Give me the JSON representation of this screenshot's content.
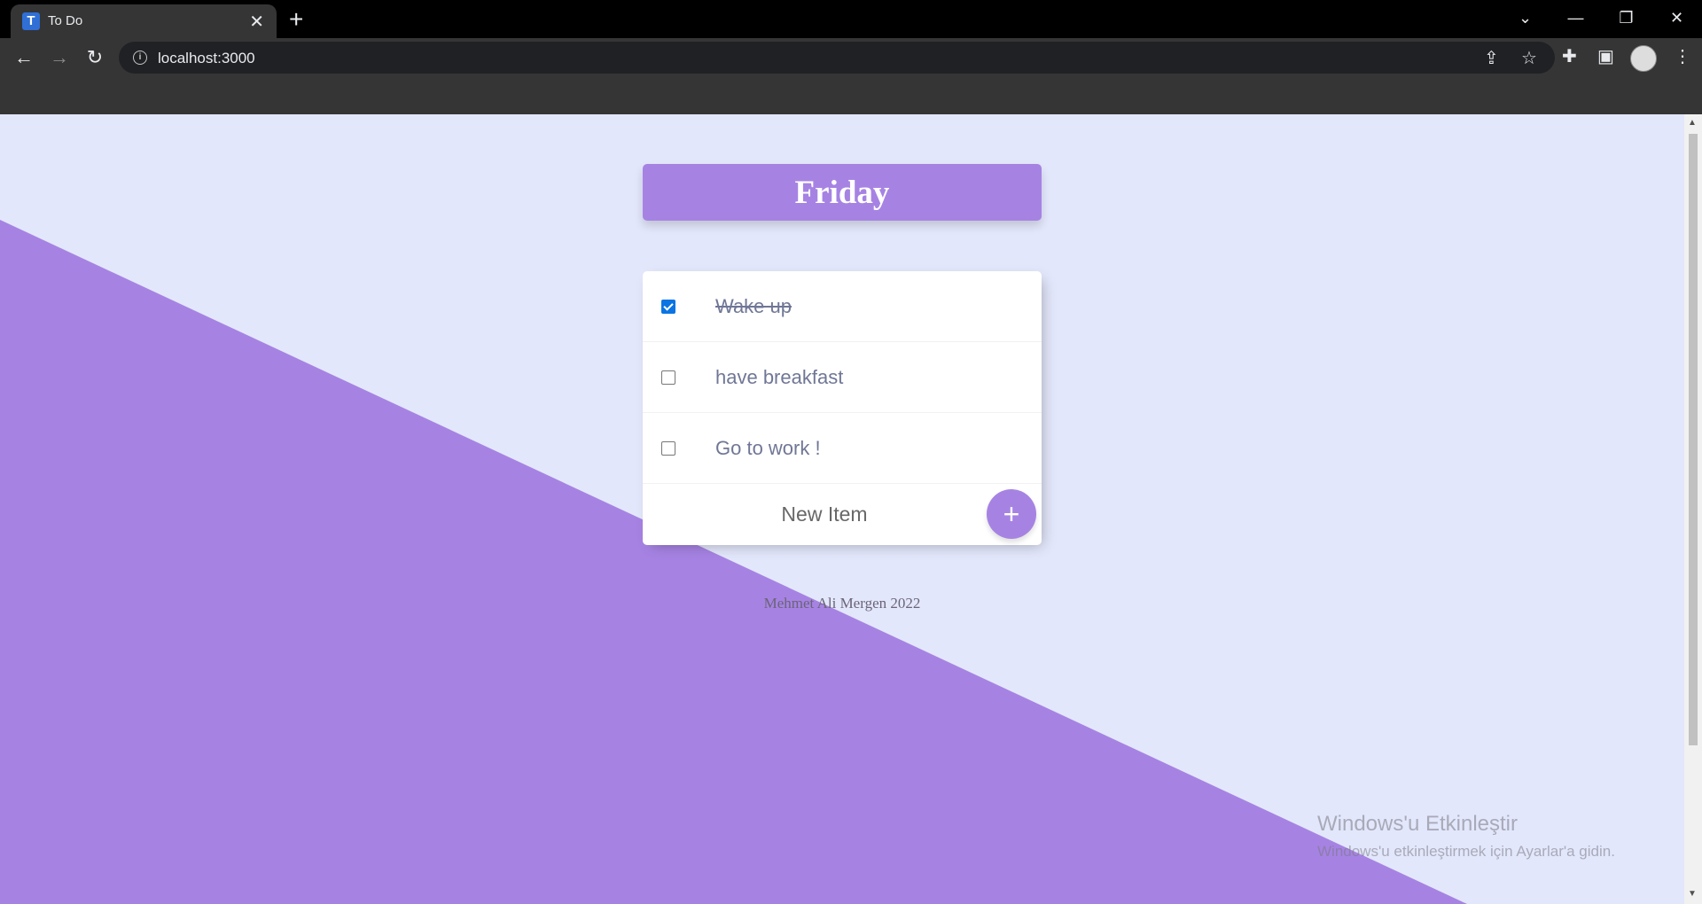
{
  "browser": {
    "tab_title": "To Do",
    "tab_favicon_letter": "T",
    "tab_close": "✕",
    "new_tab": "+",
    "url": "localhost:3000"
  },
  "page": {
    "heading": "Friday",
    "items": [
      {
        "text": "Wake up",
        "checked": true
      },
      {
        "text": "have breakfast",
        "checked": false
      },
      {
        "text": "Go to work !",
        "checked": false
      }
    ],
    "new_item_placeholder": "New Item",
    "add_button_label": "+",
    "footer": "Mehmet Ali Mergen 2022",
    "colors": {
      "accent": "#a683e3",
      "background": "#e3e7fb",
      "item_text": "#707796"
    }
  },
  "os_overlay": {
    "activation_title": "Windows'u Etkinleştir",
    "activation_subtitle": "Windows'u etkinleştirmek için Ayarlar'a gidin."
  }
}
